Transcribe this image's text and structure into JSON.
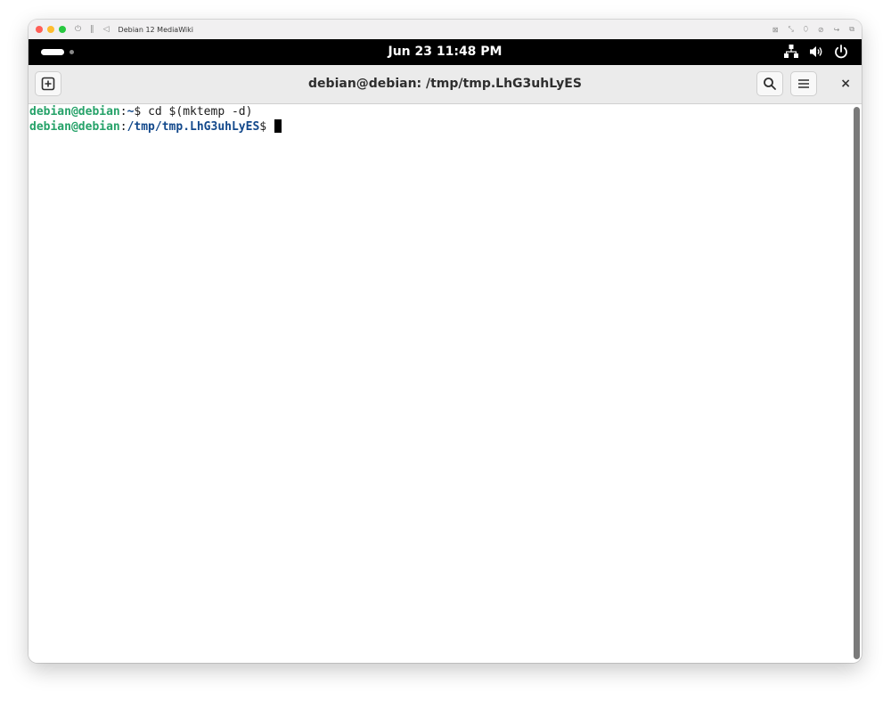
{
  "vm": {
    "title": "Debian 12 MediaWiki",
    "toolbar_icons": [
      "power-icon",
      "pause-icon",
      "back-icon"
    ],
    "right_icons": [
      "display-icon",
      "resize-icon",
      "usb-icon",
      "network-icon",
      "share-icon",
      "window-icon"
    ]
  },
  "topbar": {
    "date": "Jun 23",
    "time": "11:48 PM",
    "clock": "Jun 23  11:48 PM"
  },
  "terminal_window": {
    "title": "debian@debian: /tmp/tmp.LhG3uhLyES",
    "close": "×"
  },
  "terminal": {
    "lines": [
      {
        "user": "debian@debian",
        "colon": ":",
        "path": "~",
        "prompt": "$ ",
        "command": "cd $(mktemp -d)"
      },
      {
        "user": "debian@debian",
        "colon": ":",
        "path": "/tmp/tmp.LhG3uhLyES",
        "prompt": "$ ",
        "command": ""
      }
    ]
  },
  "colors": {
    "prompt_user": "#26a269",
    "prompt_path": "#12488b",
    "topbar_bg": "#000000",
    "headerbar_bg": "#ebebeb"
  }
}
